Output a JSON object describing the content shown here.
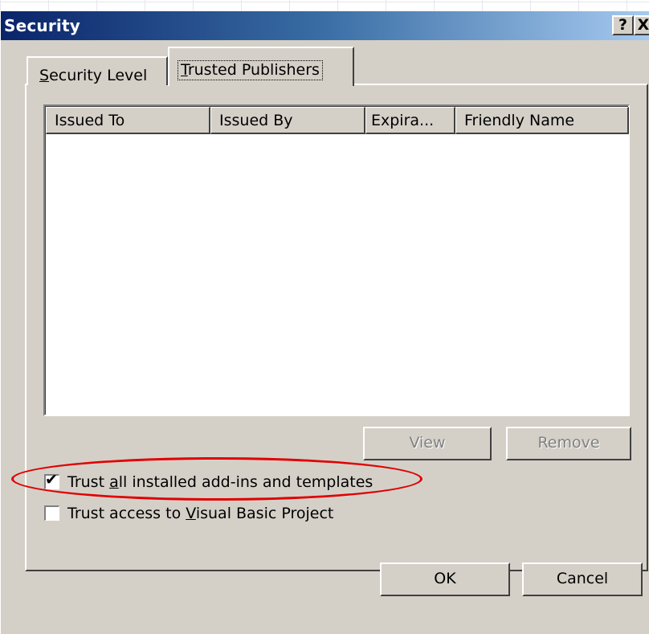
{
  "dialog": {
    "title": "Security",
    "help_label": "?",
    "close_label": "X"
  },
  "tabs": [
    {
      "label_prefix": "",
      "label_underlined": "S",
      "label_rest": "ecurity Level",
      "selected": false
    },
    {
      "label_prefix": "",
      "label_underlined": "T",
      "label_rest": "rusted Publishers",
      "selected": true
    }
  ],
  "list": {
    "columns": [
      "Issued To",
      "Issued By",
      "Expira...",
      "Friendly Name"
    ],
    "rows": []
  },
  "buttons": {
    "view": "View",
    "remove": "Remove",
    "ok": "OK",
    "cancel": "Cancel"
  },
  "checkboxes": [
    {
      "pre": "Trust ",
      "underlined": "a",
      "post": "ll installed add-ins and templates",
      "checked": true,
      "check_glyph": "✔"
    },
    {
      "pre": "Trust access to ",
      "underlined": "V",
      "post": "isual Basic Project",
      "checked": false,
      "check_glyph": ""
    }
  ],
  "annotation": {
    "color": "#e00000"
  }
}
